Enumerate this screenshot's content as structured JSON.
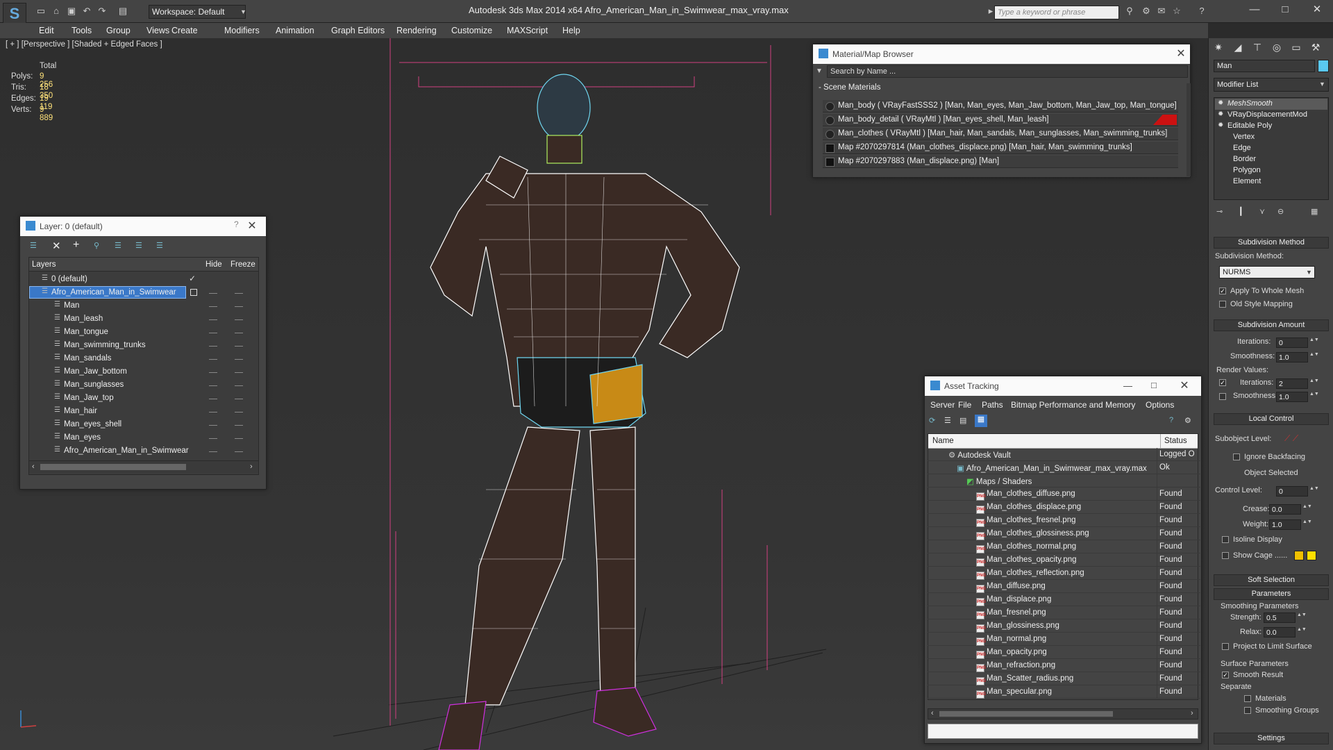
{
  "titlebar": {
    "workspace": "Workspace: Default",
    "title": "Autodesk 3ds Max  2014 x64       Afro_American_Man_in_Swimwear_max_vray.max",
    "search_placeholder": "Type a keyword or phrase"
  },
  "menu": [
    "Edit",
    "Tools",
    "Group",
    "Views",
    "Create",
    "Modifiers",
    "Animation",
    "Graph Editors",
    "Rendering",
    "Customize",
    "MAXScript",
    "Help"
  ],
  "viewport": {
    "label": "[ + ] [Perspective ] [Shaded + Edged Faces ]",
    "stats": {
      "header": "Total",
      "rows": [
        {
          "label": "Polys:",
          "value": "9 256"
        },
        {
          "label": "Tris:",
          "value": "18 350"
        },
        {
          "label": "Edges:",
          "value": "19 119"
        },
        {
          "label": "Verts:",
          "value": "9 889"
        }
      ]
    }
  },
  "layer_window": {
    "title": "Layer: 0 (default)",
    "help": "?",
    "columns": {
      "layers": "Layers",
      "hide": "Hide",
      "freeze": "Freeze"
    },
    "rows": [
      {
        "label": "0 (default)",
        "level": 0,
        "selected": false,
        "check": true
      },
      {
        "label": "Afro_American_Man_in_Swimwear",
        "level": 0,
        "selected": true,
        "check": false
      },
      {
        "label": "Man",
        "level": 1
      },
      {
        "label": "Man_leash",
        "level": 1
      },
      {
        "label": "Man_tongue",
        "level": 1
      },
      {
        "label": "Man_swimming_trunks",
        "level": 1
      },
      {
        "label": "Man_sandals",
        "level": 1
      },
      {
        "label": "Man_Jaw_bottom",
        "level": 1
      },
      {
        "label": "Man_sunglasses",
        "level": 1
      },
      {
        "label": "Man_Jaw_top",
        "level": 1
      },
      {
        "label": "Man_hair",
        "level": 1
      },
      {
        "label": "Man_eyes_shell",
        "level": 1
      },
      {
        "label": "Man_eyes",
        "level": 1
      },
      {
        "label": "Afro_American_Man_in_Swimwear",
        "level": 1
      }
    ]
  },
  "material_browser": {
    "title": "Material/Map Browser",
    "search_placeholder": "Search by Name ...",
    "section": "- Scene Materials",
    "rows": [
      {
        "label": "Man_body  ( VRayFastSSS2 )  [Man, Man_eyes, Man_Jaw_bottom, Man_Jaw_top, Man_tongue]",
        "swatch": "sphere"
      },
      {
        "label": "Man_body_detail  ( VRayMtl )  [Man_eyes_shell, Man_leash]",
        "swatch": "sphere",
        "accent": "#cc1111"
      },
      {
        "label": "Man_clothes  ( VRayMtl )  [Man_hair, Man_sandals, Man_sunglasses, Man_swimming_trunks]",
        "swatch": "sphere"
      },
      {
        "label": "Map #2070297814 (Man_clothes_displace.png) [Man_hair, Man_swimming_trunks]",
        "swatch": "square"
      },
      {
        "label": "Map #2070297883 (Man_displace.png)  [Man]",
        "swatch": "square"
      }
    ]
  },
  "asset_tracking": {
    "title": "Asset Tracking",
    "menu": [
      "Server",
      "File",
      "Paths",
      "Bitmap Performance and Memory",
      "Options"
    ],
    "columns": {
      "name": "Name",
      "status": "Status"
    },
    "rows": [
      {
        "name": "Autodesk Vault",
        "status": "Logged O",
        "indent": 0,
        "icon": "vault"
      },
      {
        "name": "Afro_American_Man_in_Swimwear_max_vray.max",
        "status": "Ok",
        "indent": 1,
        "icon": "max"
      },
      {
        "name": "Maps / Shaders",
        "status": "",
        "indent": 2,
        "icon": "folder"
      },
      {
        "name": "Man_clothes_diffuse.png",
        "status": "Found",
        "indent": 3,
        "icon": "png"
      },
      {
        "name": "Man_clothes_displace.png",
        "status": "Found",
        "indent": 3,
        "icon": "png"
      },
      {
        "name": "Man_clothes_fresnel.png",
        "status": "Found",
        "indent": 3,
        "icon": "png"
      },
      {
        "name": "Man_clothes_glossiness.png",
        "status": "Found",
        "indent": 3,
        "icon": "png"
      },
      {
        "name": "Man_clothes_normal.png",
        "status": "Found",
        "indent": 3,
        "icon": "png"
      },
      {
        "name": "Man_clothes_opacity.png",
        "status": "Found",
        "indent": 3,
        "icon": "png"
      },
      {
        "name": "Man_clothes_reflection.png",
        "status": "Found",
        "indent": 3,
        "icon": "png"
      },
      {
        "name": "Man_diffuse.png",
        "status": "Found",
        "indent": 3,
        "icon": "png"
      },
      {
        "name": "Man_displace.png",
        "status": "Found",
        "indent": 3,
        "icon": "png"
      },
      {
        "name": "Man_fresnel.png",
        "status": "Found",
        "indent": 3,
        "icon": "png"
      },
      {
        "name": "Man_glossiness.png",
        "status": "Found",
        "indent": 3,
        "icon": "png"
      },
      {
        "name": "Man_normal.png",
        "status": "Found",
        "indent": 3,
        "icon": "png"
      },
      {
        "name": "Man_opacity.png",
        "status": "Found",
        "indent": 3,
        "icon": "png"
      },
      {
        "name": "Man_refraction.png",
        "status": "Found",
        "indent": 3,
        "icon": "png"
      },
      {
        "name": "Man_Scatter_radius.png",
        "status": "Found",
        "indent": 3,
        "icon": "png"
      },
      {
        "name": "Man_specular.png",
        "status": "Found",
        "indent": 3,
        "icon": "png"
      }
    ]
  },
  "command_panel": {
    "object_name": "Man",
    "modifier_list": "Modifier List",
    "stack": [
      {
        "label": "MeshSmooth",
        "italic": true,
        "selected": true
      },
      {
        "label": "VRayDisplacementMod",
        "italic": false
      },
      {
        "label": "Editable Poly",
        "italic": false
      },
      {
        "label": "Vertex",
        "sub": true
      },
      {
        "label": "Edge",
        "sub": true
      },
      {
        "label": "Border",
        "sub": true
      },
      {
        "label": "Polygon",
        "sub": true
      },
      {
        "label": "Element",
        "sub": true
      }
    ],
    "subdivision_method": {
      "title": "Subdivision Method",
      "label": "Subdivision Method:",
      "value": "NURMS",
      "apply_whole": "Apply To Whole Mesh",
      "old_style": "Old Style Mapping"
    },
    "subdivision_amount": {
      "title": "Subdivision Amount",
      "iterations_label": "Iterations:",
      "iterations": "0",
      "smoothness_label": "Smoothness:",
      "smoothness": "1.0",
      "render_values": "Render Values:",
      "r_iterations_label": "Iterations:",
      "r_iterations": "2",
      "r_smoothness_label": "Smoothness:",
      "r_smoothness": "1.0"
    },
    "local_control": {
      "title": "Local Control",
      "sublevel_label": "Subobject Level:",
      "ignore_backfacing": "Ignore Backfacing",
      "object_selected": "Object Selected",
      "control_level_label": "Control Level:",
      "control_level": "0",
      "crease_label": "Crease:",
      "crease": "0.0",
      "weight_label": "Weight:",
      "weight": "1.0",
      "isoline": "Isoline Display",
      "show_cage": "Show Cage ......",
      "cage_color_1": "#f0c000",
      "cage_color_2": "#ffe000"
    },
    "soft_selection": {
      "title": "Soft Selection"
    },
    "parameters": {
      "title": "Parameters",
      "smoothing_params": "Smoothing Parameters",
      "strength_label": "Strength:",
      "strength": "0.5",
      "relax_label": "Relax:",
      "relax": "0.0",
      "project_limit": "Project to Limit Surface",
      "surface_params": "Surface Parameters",
      "smooth_result": "Smooth Result",
      "separate": "Separate",
      "materials": "Materials",
      "smoothing_groups": "Smoothing Groups"
    },
    "settings": {
      "title": "Settings"
    }
  },
  "colors": {
    "wire_body": "#ffffff",
    "wire_trunks": "#6fd6f0",
    "wire_sandals": "#d030e0",
    "body_fill": "#3a2a24",
    "bbox": "#d04080"
  }
}
